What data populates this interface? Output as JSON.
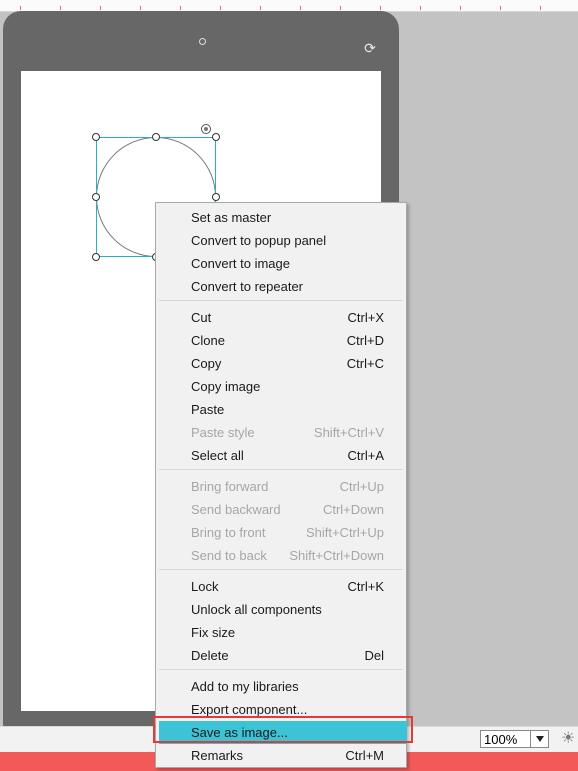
{
  "context_menu": {
    "items": [
      {
        "label": "Set as master",
        "shortcut": ""
      },
      {
        "label": "Convert to popup panel",
        "shortcut": ""
      },
      {
        "label": "Convert to image",
        "shortcut": ""
      },
      {
        "label": "Convert to repeater",
        "shortcut": ""
      },
      {
        "label": "Cut",
        "shortcut": "Ctrl+X"
      },
      {
        "label": "Clone",
        "shortcut": "Ctrl+D"
      },
      {
        "label": "Copy",
        "shortcut": "Ctrl+C"
      },
      {
        "label": "Copy image",
        "shortcut": ""
      },
      {
        "label": "Paste",
        "shortcut": ""
      },
      {
        "label": "Paste style",
        "shortcut": "Shift+Ctrl+V"
      },
      {
        "label": "Select all",
        "shortcut": "Ctrl+A"
      },
      {
        "label": "Bring forward",
        "shortcut": "Ctrl+Up"
      },
      {
        "label": "Send backward",
        "shortcut": "Ctrl+Down"
      },
      {
        "label": "Bring to front",
        "shortcut": "Shift+Ctrl+Up"
      },
      {
        "label": "Send to back",
        "shortcut": "Shift+Ctrl+Down"
      },
      {
        "label": "Lock",
        "shortcut": "Ctrl+K"
      },
      {
        "label": "Unlock all components",
        "shortcut": ""
      },
      {
        "label": "Fix size",
        "shortcut": ""
      },
      {
        "label": "Delete",
        "shortcut": "Del"
      },
      {
        "label": "Add to my libraries",
        "shortcut": ""
      },
      {
        "label": "Export component...",
        "shortcut": ""
      },
      {
        "label": "Save as image...",
        "shortcut": ""
      },
      {
        "label": "Remarks",
        "shortcut": "Ctrl+M"
      }
    ]
  },
  "status_bar": {
    "zoom_value": "100%"
  },
  "colors": {
    "highlight": "#3cc4d6",
    "annotation_frame": "#e53935",
    "selection": "#2bb0bd",
    "device_body": "#676767"
  },
  "icons": {
    "rotate": "rotate-screen-icon",
    "zoom_dropdown": "chevron-down-icon",
    "settings": "sun-icon"
  }
}
